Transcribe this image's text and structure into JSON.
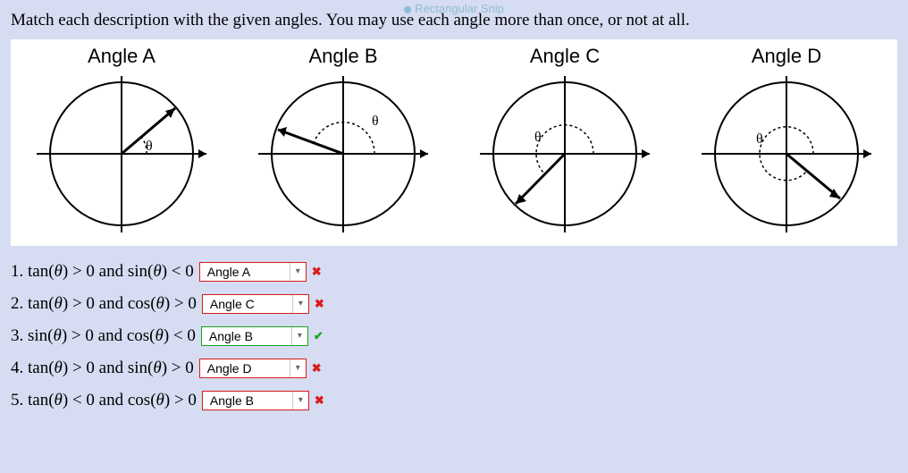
{
  "watermark": "Rectangular Snip",
  "instruction": "Match each description with the given angles. You may use each angle more than once, or not at all.",
  "angle_labels": {
    "a": "Angle A",
    "b": "Angle B",
    "c": "Angle C",
    "d": "Angle D"
  },
  "theta": "θ",
  "questions": [
    {
      "num": "1.",
      "fn1": "tan",
      "op1": ">",
      "conj": "and",
      "fn2": "sin",
      "op2": "<",
      "selected": "Angle A",
      "status": "incorrect",
      "mark": "✖"
    },
    {
      "num": "2.",
      "fn1": "tan",
      "op1": ">",
      "conj": "and",
      "fn2": "cos",
      "op2": ">",
      "selected": "Angle C",
      "status": "incorrect",
      "mark": "✖"
    },
    {
      "num": "3.",
      "fn1": "sin",
      "op1": ">",
      "conj": "and",
      "fn2": "cos",
      "op2": "<",
      "selected": "Angle B",
      "status": "correct",
      "mark": "✔"
    },
    {
      "num": "4.",
      "fn1": "tan",
      "op1": ">",
      "conj": "and",
      "fn2": "sin",
      "op2": ">",
      "selected": "Angle D",
      "status": "incorrect",
      "mark": "✖"
    },
    {
      "num": "5.",
      "fn1": "tan",
      "op1": "<",
      "conj": "and",
      "fn2": "cos",
      "op2": ">",
      "selected": "Angle B",
      "status": "incorrect",
      "mark": "✖"
    }
  ],
  "zero": "0"
}
